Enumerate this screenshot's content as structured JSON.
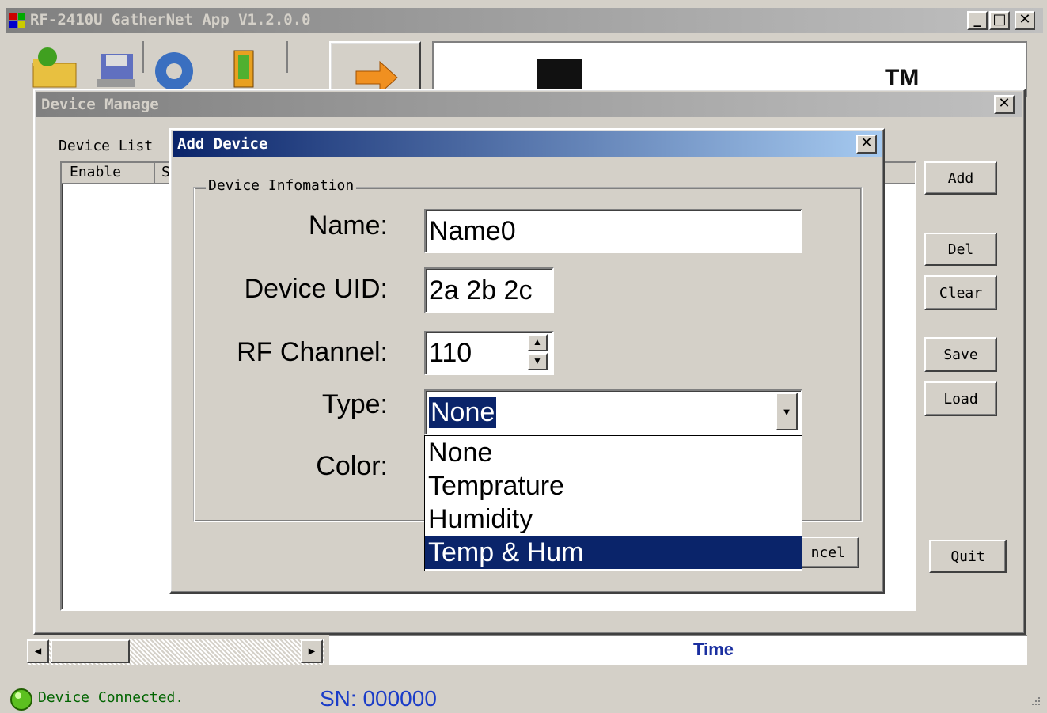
{
  "app": {
    "title": "RF-2410U GatherNet App V1.2.0.0",
    "logo_text": "TM"
  },
  "toolbar": {
    "icons": [
      "open-folder-icon",
      "save-disk-icon",
      "settings-gear-icon",
      "device-icon",
      "export-arrow-icon"
    ]
  },
  "device_manage": {
    "title": "Device Manage",
    "list_label": "Device List",
    "columns": [
      "Enable",
      "S"
    ],
    "buttons": {
      "add": "Add",
      "del": "Del",
      "clear": "Clear",
      "save": "Save",
      "load": "Load",
      "quit": "Quit"
    }
  },
  "add_device": {
    "title": "Add Device",
    "group_label": "Device Infomation",
    "name_label": "Name:",
    "name_value": "Name0",
    "uid_label": "Device UID:",
    "uid_value": "2a 2b 2c",
    "channel_label": "RF Channel:",
    "channel_value": "110",
    "type_label": "Type:",
    "type_value": "None",
    "color_label": "Color:",
    "type_options": [
      "None",
      "Temprature",
      "Humidity",
      "Temp & Hum"
    ],
    "type_highlighted": "Temp & Hum",
    "cancel_label_visible": "ncel"
  },
  "main": {
    "time_label": "Time"
  },
  "status": {
    "connection": "Device Connected.",
    "sn": "SN: 000000"
  },
  "colors": {
    "active_title_start": "#0a246a",
    "active_title_end": "#a6caf0",
    "selection": "#0a246a",
    "status_text": "#006400",
    "sn_text": "#1a3cc8",
    "time_text": "#1a2fa0"
  }
}
